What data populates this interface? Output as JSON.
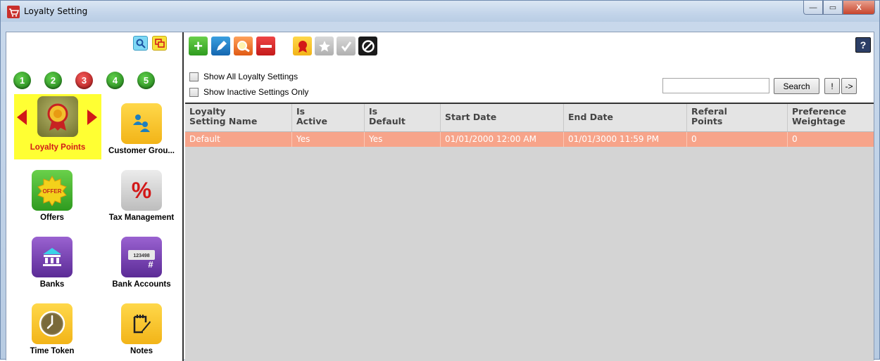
{
  "window": {
    "title": "Loyalty Setting",
    "minimize": "—",
    "maximize": "▭",
    "close": "X"
  },
  "left": {
    "numbers": [
      "1",
      "2",
      "3",
      "4",
      "5"
    ],
    "modules": [
      {
        "label": "Loyalty Points",
        "icon": "ribbon-icon"
      },
      {
        "label": "Customer Grou...",
        "icon": "customers-icon"
      },
      {
        "label": "Offers",
        "icon": "offer-icon",
        "tile_text": "OFFER"
      },
      {
        "label": "Tax Management",
        "icon": "percent-icon",
        "tile_text": "%"
      },
      {
        "label": "Banks",
        "icon": "bank-icon"
      },
      {
        "label": "Bank Accounts",
        "icon": "bank-account-icon",
        "tile_text": "123498",
        "tile_mark": "#"
      },
      {
        "label": "Time Token",
        "icon": "clock-icon"
      },
      {
        "label": "Notes",
        "icon": "notes-icon"
      }
    ]
  },
  "filters": {
    "show_all": "Show All Loyalty Settings",
    "show_inactive": "Show Inactive Settings Only"
  },
  "search": {
    "value": "",
    "button": "Search",
    "exclaim": "!",
    "arrow": "->"
  },
  "help": "?",
  "grid": {
    "columns": [
      [
        "Loyalty",
        "Setting Name"
      ],
      [
        "Is",
        "Active"
      ],
      [
        "Is",
        "Default"
      ],
      [
        "Start Date"
      ],
      [
        "End Date"
      ],
      [
        "Referal",
        "Points"
      ],
      [
        "Preference",
        "Weightage"
      ]
    ],
    "rows": [
      [
        "Default",
        "Yes",
        "Yes",
        "01/01/2000 12:00 AM",
        "01/01/3000 11:59 PM",
        "0",
        "0"
      ]
    ]
  }
}
